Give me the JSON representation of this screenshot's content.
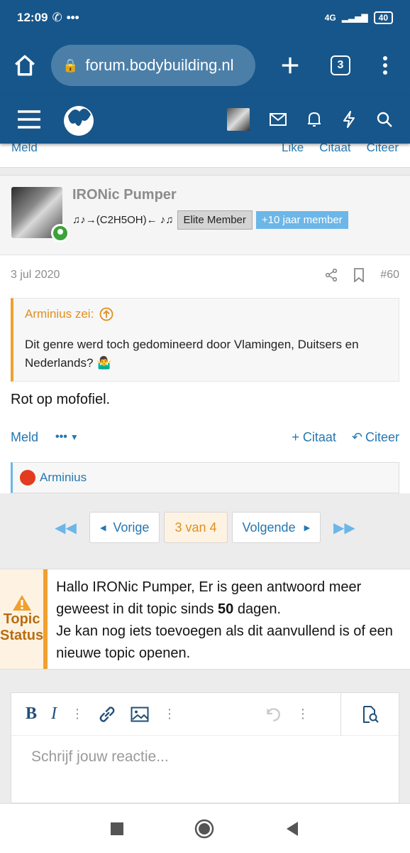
{
  "statusbar": {
    "time": "12:09",
    "network": "4G",
    "battery": "40"
  },
  "browser": {
    "url": "forum.bodybuilding.nl",
    "tab_count": "3"
  },
  "prev_actions": {
    "report": "Meld",
    "like": "Like",
    "quote": "Citaat",
    "reply": "Citeer"
  },
  "post": {
    "username": "IRONic Pumper",
    "user_title": "♫♪→(C2H5OH)← ♪♫",
    "badges": [
      "Elite Member",
      "+10 jaar member"
    ],
    "date": "3 jul 2020",
    "number": "#60",
    "quote": {
      "author": "Arminius zei:",
      "text": "Dit genre werd toch gedomineerd door Vlamingen, Duitsers en Nederlands? 🤷‍♂️"
    },
    "message": "Rot op mofofiel.",
    "actions": {
      "report": "Meld",
      "more": "•••",
      "quote": "+ Citaat",
      "reply": "Citeer"
    },
    "reactions": {
      "user": "Arminius"
    }
  },
  "pagination": {
    "prev": "Vorige",
    "current": "3 van 4",
    "next": "Volgende"
  },
  "topic_status": {
    "label_line1": "Topic",
    "label_line2": "Status",
    "text_before": "Hallo IRONic Pumper, Er is geen antwoord meer geweest in dit topic sinds ",
    "days": "50",
    "text_after": " dagen.",
    "line2": "Je kan nog iets toevoegen als dit aanvullend is of een nieuwe topic openen."
  },
  "editor": {
    "placeholder": "Schrijf jouw reactie..."
  },
  "colors": {
    "brand": "#17568a",
    "link": "#2577b1",
    "accent": "#f0a030"
  }
}
